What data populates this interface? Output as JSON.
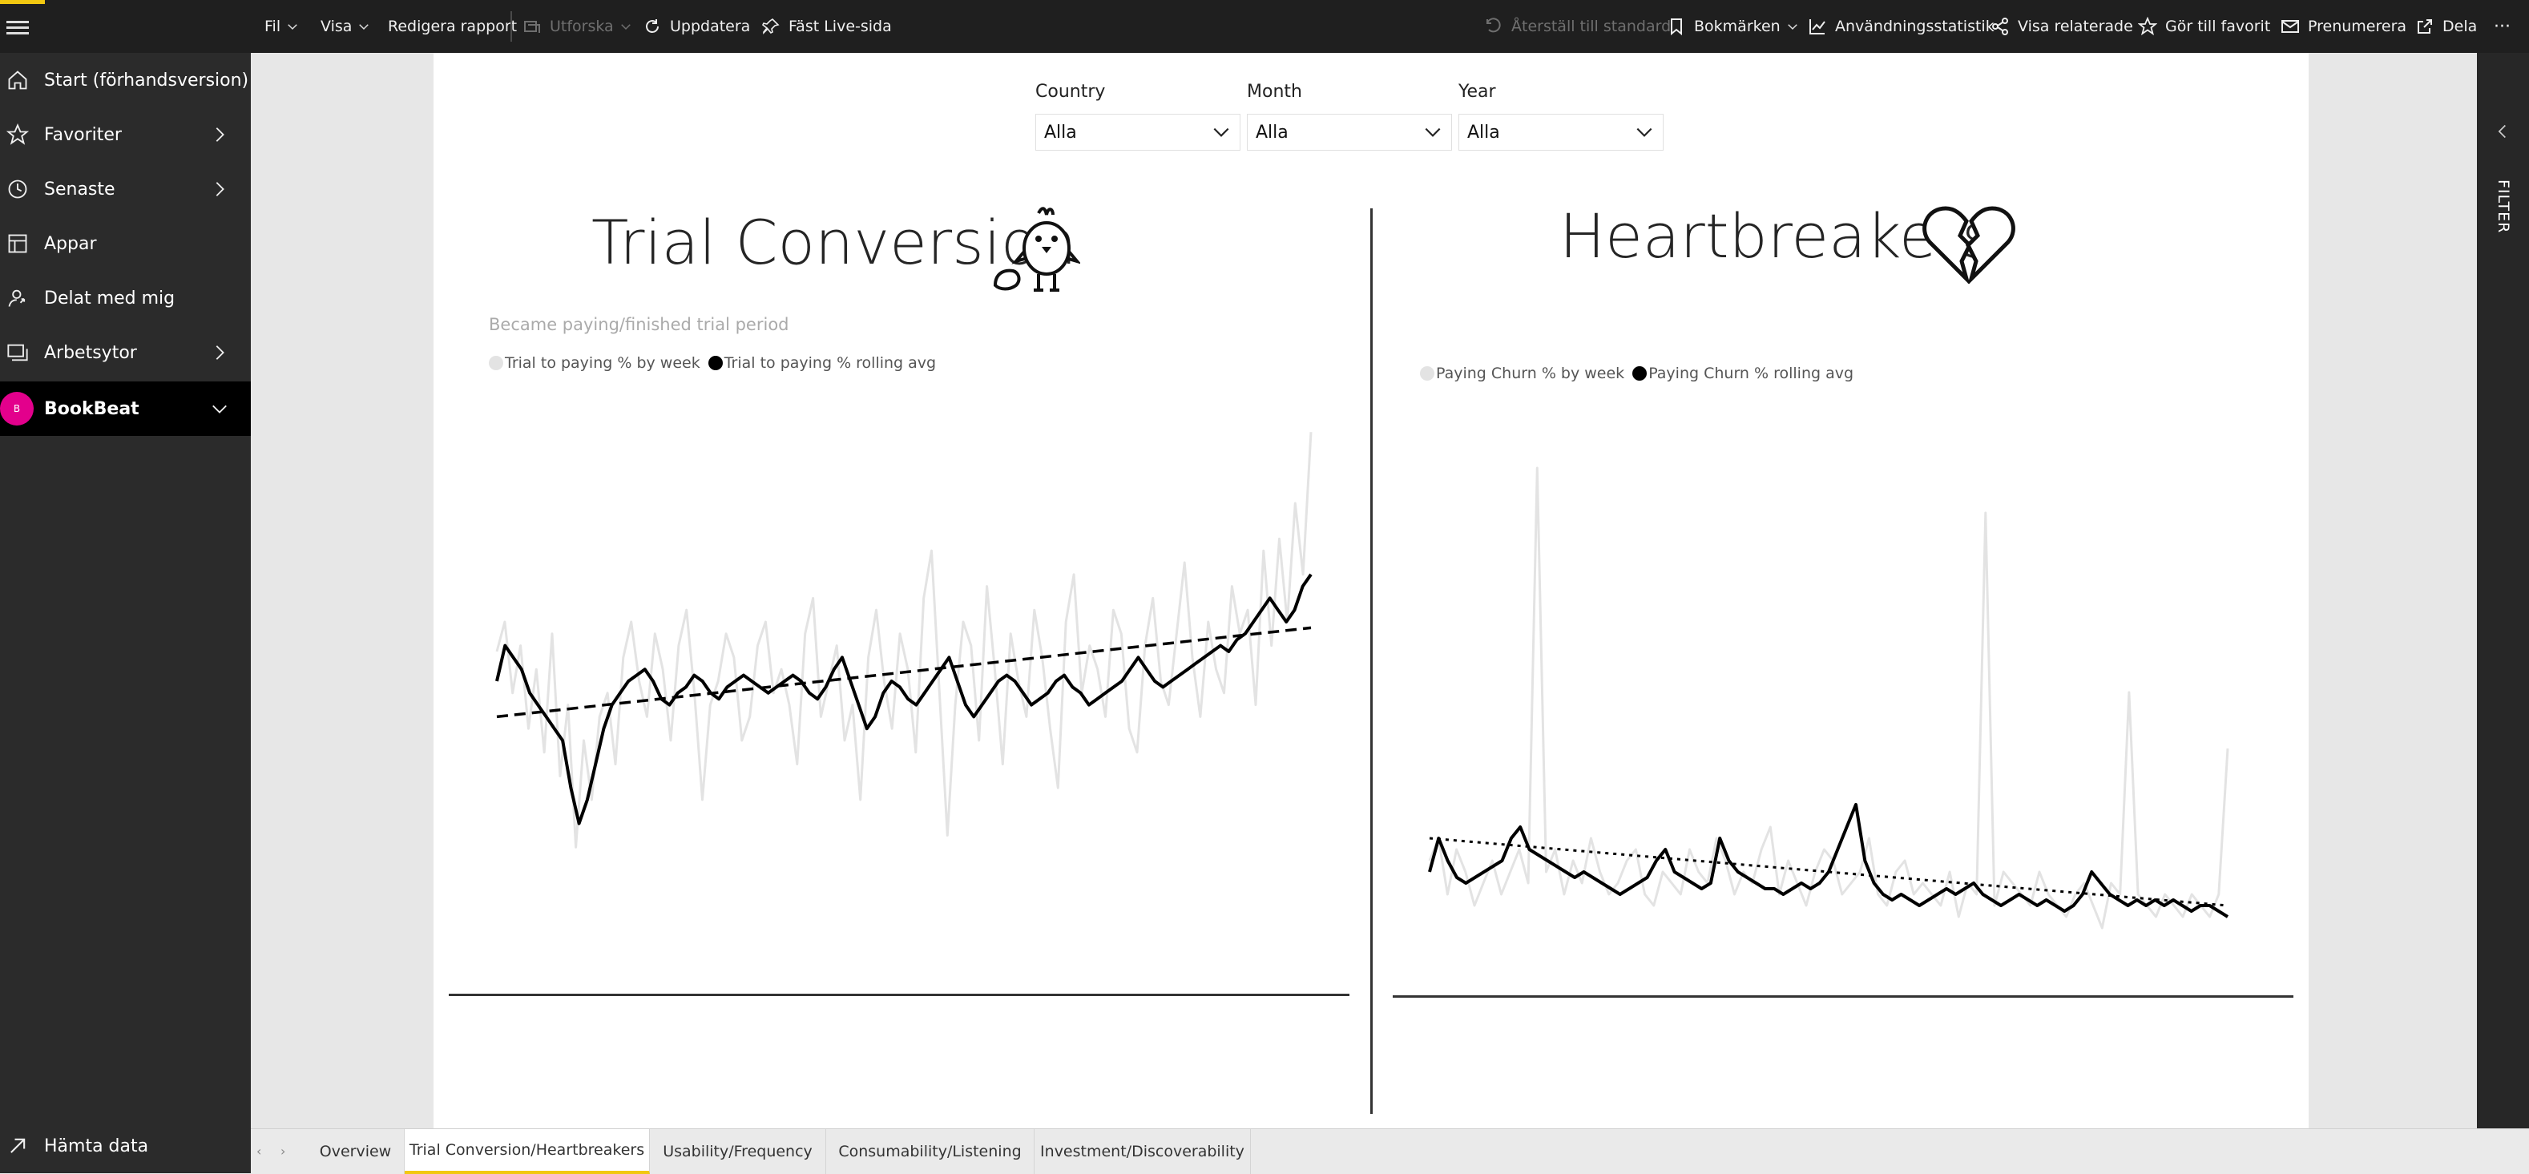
{
  "topbar": {
    "left_items": [
      {
        "label": "Fil",
        "icon": "chevron-down-icon"
      },
      {
        "label": "Visa",
        "icon": "chevron-down-icon"
      },
      {
        "label": "Redigera rapport"
      },
      {
        "label": "Utforska",
        "icon": "explore-icon",
        "disabled": true
      },
      {
        "label": "Uppdatera",
        "icon": "refresh-icon"
      },
      {
        "label": "Fäst Live-sida",
        "icon": "pin-icon"
      }
    ],
    "right_items": [
      {
        "label": "Återställ till standard",
        "icon": "undo-icon",
        "disabled": true
      },
      {
        "label": "Bokmärken",
        "icon": "bookmark-icon"
      },
      {
        "label": "Användningsstatistik",
        "icon": "usage-chart-icon"
      },
      {
        "label": "Visa relaterade",
        "icon": "share-network-icon"
      },
      {
        "label": "Gör till favorit",
        "icon": "star-icon"
      },
      {
        "label": "Prenumerera",
        "icon": "mail-icon"
      },
      {
        "label": "Dela",
        "icon": "share-icon"
      },
      {
        "label": "···"
      }
    ]
  },
  "sidebar": {
    "items": [
      {
        "label": "Start (förhandsversion)",
        "icon": "home-icon"
      },
      {
        "label": "Favoriter",
        "icon": "star-icon",
        "chevron": true
      },
      {
        "label": "Senaste",
        "icon": "clock-icon",
        "chevron": true
      },
      {
        "label": "Appar",
        "icon": "apps-icon"
      },
      {
        "label": "Delat med mig",
        "icon": "shared-person-icon"
      },
      {
        "label": "Arbetsytor",
        "icon": "workspaces-icon",
        "chevron": true
      },
      {
        "label": "BookBeat",
        "icon": "workspace-avatar",
        "avatar_letter": "B",
        "active": true
      }
    ],
    "bottom": {
      "label": "Hämta data",
      "icon": "arrow-up-right-icon"
    }
  },
  "filter_pane": {
    "label": "FILTER"
  },
  "slicers": [
    {
      "title": "Country",
      "value": "Alla"
    },
    {
      "title": "Month",
      "value": "Alla"
    },
    {
      "title": "Year",
      "value": "Alla"
    }
  ],
  "left_chart_header": {
    "title": "Trial Conversion",
    "subtitle": "Became paying/finished trial period",
    "legend": [
      "Trial to paying % by week",
      "Trial to paying % rolling avg"
    ],
    "legend_colors": [
      "#e3e3e3",
      "#000000"
    ]
  },
  "right_chart_header": {
    "title": "Heartbreakers",
    "legend": [
      "Paying Churn % by week",
      "Paying Churn % rolling avg"
    ],
    "legend_colors": [
      "#e3e3e3",
      "#000000"
    ]
  },
  "chart_data": [
    {
      "type": "line",
      "title": "Trial Conversion",
      "subtitle": "Became paying/finished trial period",
      "ylim": [
        0,
        100
      ],
      "grid": false,
      "legend_position": "top-left",
      "series": [
        {
          "name": "Trial to paying % by week",
          "color": "#e3e3e3",
          "values": [
            55,
            60,
            48,
            56,
            42,
            52,
            38,
            58,
            34,
            46,
            22,
            40,
            30,
            44,
            48,
            36,
            54,
            60,
            50,
            44,
            58,
            52,
            40,
            56,
            62,
            48,
            30,
            46,
            50,
            58,
            54,
            40,
            44,
            56,
            60,
            48,
            52,
            46,
            36,
            58,
            64,
            44,
            50,
            56,
            40,
            46,
            30,
            54,
            62,
            50,
            42,
            58,
            52,
            38,
            64,
            72,
            48,
            24,
            46,
            60,
            56,
            40,
            66,
            52,
            36,
            58,
            50,
            44,
            62,
            54,
            42,
            32,
            60,
            68,
            48,
            56,
            52,
            44,
            62,
            58,
            42,
            38,
            56,
            64,
            50,
            46,
            58,
            70,
            54,
            44,
            60,
            52,
            48,
            66,
            58,
            62,
            46,
            72,
            56,
            74,
            60,
            80,
            68,
            92
          ]
        },
        {
          "name": "Trial to paying % rolling avg",
          "color": "#000000",
          "values": [
            50,
            56,
            54,
            52,
            48,
            46,
            44,
            42,
            40,
            32,
            26,
            30,
            36,
            42,
            46,
            48,
            50,
            51,
            52,
            50,
            47,
            46,
            48,
            49,
            51,
            50,
            48,
            47,
            49,
            50,
            51,
            50,
            49,
            48,
            49,
            50,
            51,
            50,
            48,
            47,
            49,
            52,
            54,
            50,
            46,
            42,
            44,
            48,
            50,
            49,
            47,
            46,
            48,
            50,
            52,
            54,
            50,
            46,
            44,
            46,
            48,
            50,
            51,
            50,
            48,
            46,
            47,
            48,
            50,
            51,
            49,
            48,
            46,
            47,
            48,
            49,
            50,
            52,
            54,
            52,
            50,
            49,
            50,
            51,
            52,
            53,
            54,
            55,
            56,
            55,
            57,
            58,
            60,
            62,
            64,
            62,
            60,
            62,
            66,
            68
          ]
        },
        {
          "name": "",
          "color": "#000000",
          "style": "dashed",
          "values": [
            44,
            59
          ]
        }
      ]
    },
    {
      "type": "line",
      "title": "Heartbreakers",
      "ylim": [
        0,
        100
      ],
      "grid": false,
      "legend_position": "top-left",
      "series": [
        {
          "name": "Paying Churn % by week",
          "color": "#e3e3e3",
          "values": [
            18,
            22,
            12,
            20,
            16,
            10,
            14,
            18,
            12,
            16,
            20,
            14,
            88,
            16,
            20,
            12,
            18,
            14,
            22,
            16,
            12,
            14,
            18,
            20,
            12,
            10,
            16,
            14,
            12,
            20,
            16,
            14,
            22,
            18,
            12,
            16,
            14,
            20,
            24,
            12,
            18,
            14,
            10,
            16,
            20,
            18,
            12,
            14,
            16,
            22,
            12,
            10,
            16,
            18,
            12,
            14,
            12,
            10,
            16,
            8,
            14,
            12,
            80,
            10,
            16,
            14,
            12,
            10,
            16,
            12,
            10,
            8,
            12,
            14,
            10,
            6,
            14,
            12,
            48,
            12,
            10,
            8,
            12,
            10,
            8,
            12,
            10,
            8,
            12,
            38
          ]
        },
        {
          "name": "Paying Churn % rolling avg",
          "color": "#000000",
          "values": [
            16,
            22,
            18,
            15,
            14,
            15,
            16,
            17,
            18,
            22,
            24,
            20,
            19,
            18,
            17,
            16,
            15,
            16,
            15,
            14,
            13,
            12,
            13,
            14,
            15,
            18,
            20,
            16,
            15,
            14,
            13,
            14,
            22,
            18,
            16,
            15,
            14,
            13,
            13,
            12,
            13,
            14,
            13,
            14,
            16,
            20,
            24,
            28,
            18,
            14,
            12,
            11,
            12,
            11,
            10,
            11,
            12,
            13,
            12,
            13,
            14,
            12,
            11,
            10,
            11,
            12,
            11,
            10,
            11,
            10,
            9,
            10,
            12,
            16,
            14,
            12,
            11,
            10,
            11,
            10,
            11,
            10,
            11,
            10,
            9,
            10,
            10,
            9,
            8
          ]
        },
        {
          "name": "",
          "color": "#000000",
          "style": "dotted",
          "values": [
            22,
            10
          ]
        }
      ]
    }
  ],
  "tabs": {
    "items": [
      "Overview",
      "Trial Conversion/Heartbreakers",
      "Usability/Frequency",
      "Consumability/Listening",
      "Investment/Discoverability"
    ],
    "active": 1
  }
}
